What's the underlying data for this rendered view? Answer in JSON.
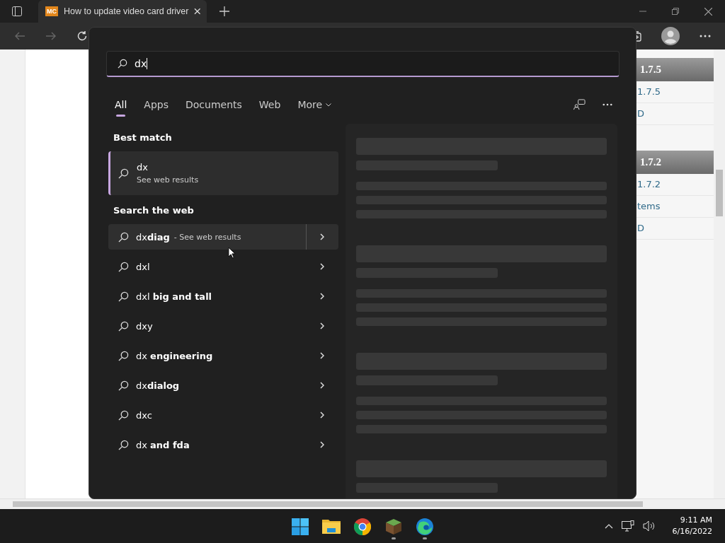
{
  "browser": {
    "tab": {
      "favicon": "MC",
      "title": "How to update video card driver"
    }
  },
  "page": {
    "sections": [
      {
        "heading": "1.7.5",
        "links": [
          "1.7.5",
          "D"
        ]
      },
      {
        "heading": "1.7.2",
        "links": [
          "1.7.2",
          "tems",
          "D"
        ]
      }
    ]
  },
  "search": {
    "query": "dx",
    "filters": [
      {
        "label": "All",
        "selected": true
      },
      {
        "label": "Apps",
        "selected": false
      },
      {
        "label": "Documents",
        "selected": false
      },
      {
        "label": "Web",
        "selected": false
      },
      {
        "label": "More",
        "selected": false
      }
    ],
    "best_match_heading": "Best match",
    "best_match": {
      "title": "dx",
      "subtitle": "See web results"
    },
    "web_heading": "Search the web",
    "suggestions": [
      {
        "text": "dx**diag**",
        "hint": "- See web results",
        "selected": true
      },
      {
        "text": "dxl",
        "selected": false
      },
      {
        "text": "dxl **big and tall**",
        "selected": false
      },
      {
        "text": "dxy",
        "selected": false
      },
      {
        "text": "dx **engineering**",
        "selected": false
      },
      {
        "text": "dx**dialog**",
        "selected": false
      },
      {
        "text": "dxc",
        "selected": false
      },
      {
        "text": "dx **and fda**",
        "selected": false
      }
    ]
  },
  "taskbar": {
    "apps": [
      {
        "kind": "start",
        "running": false
      },
      {
        "kind": "folder",
        "running": false
      },
      {
        "kind": "chrome",
        "running": false
      },
      {
        "kind": "minecraft",
        "running": true
      },
      {
        "kind": "edge",
        "running": true
      }
    ],
    "time": "9:11 AM",
    "date": "6/16/2022"
  }
}
